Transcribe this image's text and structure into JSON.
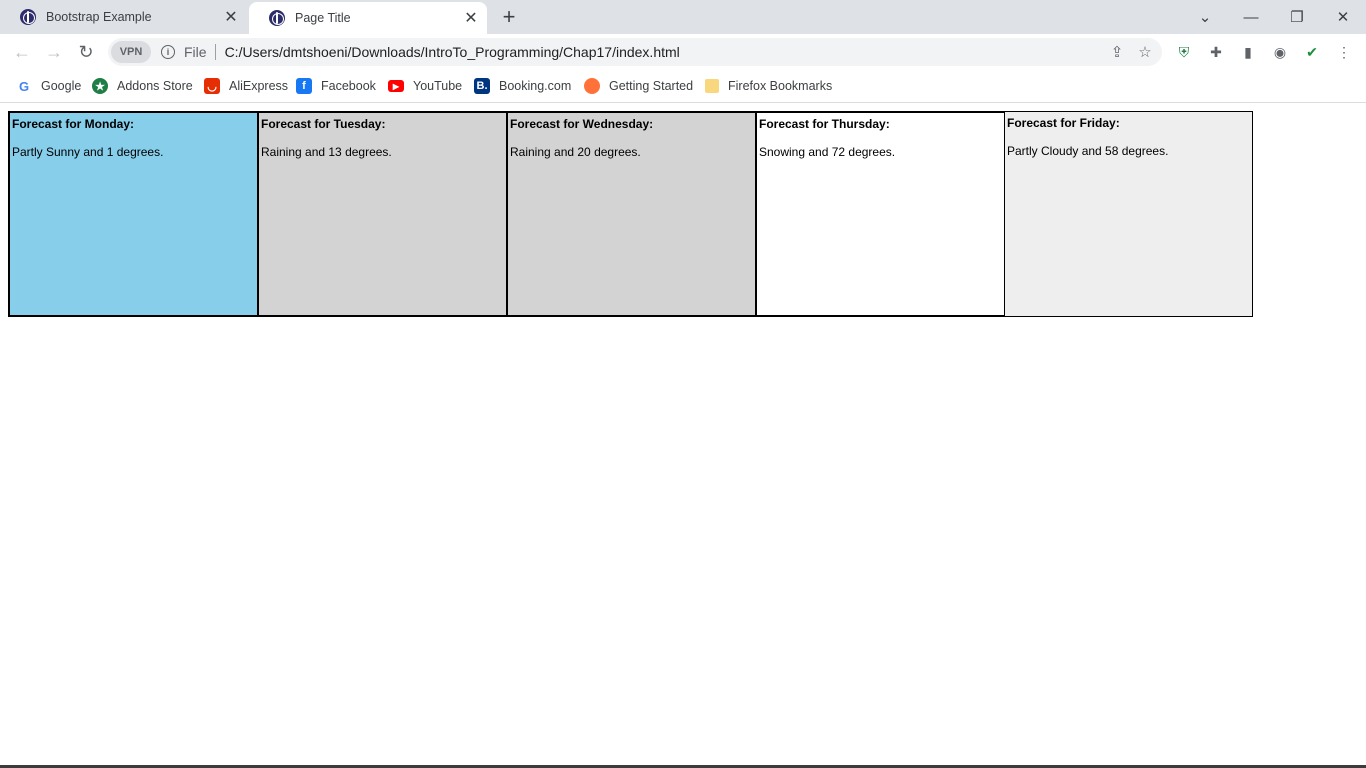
{
  "browser": {
    "tabs": [
      {
        "title": "Bootstrap Example",
        "active": false
      },
      {
        "title": "Page Title",
        "active": true
      }
    ],
    "new_tab_icon": "plus-icon",
    "window_controls": [
      "chevron-down-icon",
      "minimize-icon",
      "restore-icon",
      "close-icon"
    ],
    "address_bar": {
      "vpn_label": "VPN",
      "scheme_label": "File",
      "url": "C:/Users/dmtshoeni/Downloads/IntroTo_Programming/Chap17/index.html"
    },
    "bookmarks": [
      {
        "label": "Google",
        "icon": "google-icon",
        "color": "#4285f4"
      },
      {
        "label": "Addons Store",
        "icon": "addons-store-icon",
        "color": "#1e7e45"
      },
      {
        "label": "AliExpress",
        "icon": "aliexpress-icon",
        "color": "#e62e04"
      },
      {
        "label": "Facebook",
        "icon": "facebook-icon",
        "color": "#1877f2"
      },
      {
        "label": "YouTube",
        "icon": "youtube-icon",
        "color": "#ff0000"
      },
      {
        "label": "Booking.com",
        "icon": "booking-icon",
        "color": "#003580"
      },
      {
        "label": "Getting Started",
        "icon": "firefox-icon",
        "color": "#ff7139"
      },
      {
        "label": "Firefox Bookmarks",
        "icon": "folder-icon",
        "color": "#f9d77e"
      }
    ]
  },
  "forecast": [
    {
      "title": "Forecast for Monday:",
      "text": "Partly Sunny and 1 degrees.",
      "color": "#87ceeb"
    },
    {
      "title": "Forecast for Tuesday:",
      "text": "Raining and 13 degrees.",
      "color": "#d3d3d3"
    },
    {
      "title": "Forecast for Wednesday:",
      "text": "Raining and 20 degrees.",
      "color": "#d3d3d3"
    },
    {
      "title": "Forecast for Thursday:",
      "text": "Snowing and 72 degrees.",
      "color": "#ffffff"
    },
    {
      "title": "Forecast for Friday:",
      "text": "Partly Cloudy and 58 degrees.",
      "color": "#eeeeee"
    }
  ]
}
